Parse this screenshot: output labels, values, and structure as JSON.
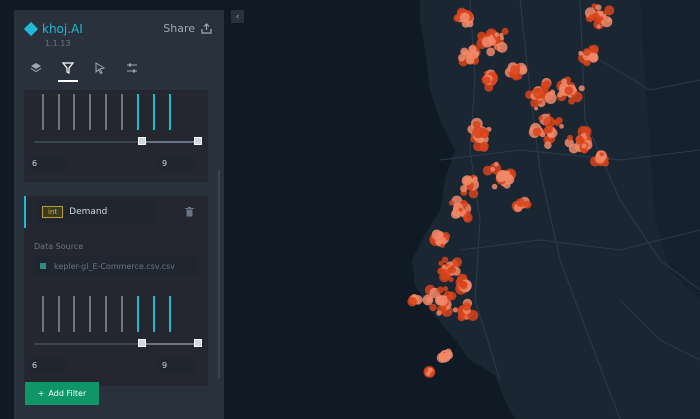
{
  "app": {
    "name": "khoj.AI",
    "version": "1.1.13",
    "share_label": "Share"
  },
  "tabs": [
    {
      "name": "layers"
    },
    {
      "name": "filters"
    },
    {
      "name": "interactions"
    },
    {
      "name": "map-settings"
    }
  ],
  "filters": [
    {
      "min_value": "6",
      "max_value": "9"
    },
    {
      "field_type": "int",
      "field_name": "Demand",
      "data_source_label": "Data Source",
      "data_source": "kepler-gl_E-Commerce.csv.csv",
      "min_value": "6",
      "max_value": "9"
    }
  ],
  "add_filter_label": "Add Filter",
  "colors": {
    "accent": "#1fbad6",
    "panel": "#29323c",
    "button": "#0f9668",
    "points": "#e64b1c",
    "map_bg": "#0f1a24"
  }
}
